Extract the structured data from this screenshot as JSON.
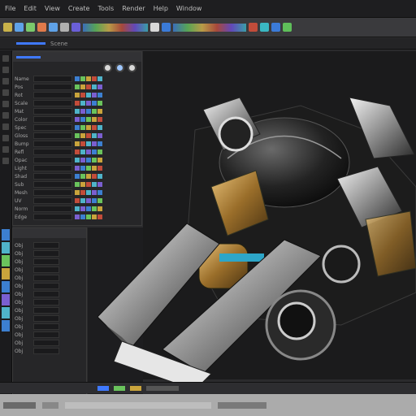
{
  "menubar": {
    "items": [
      "File",
      "Edit",
      "View",
      "Create",
      "Tools",
      "Render",
      "Help",
      "Window"
    ]
  },
  "tabrow": {
    "label": "Scene"
  },
  "left_panel": {
    "rows": [
      {
        "label": "Name"
      },
      {
        "label": "Pos"
      },
      {
        "label": "Rot"
      },
      {
        "label": "Scale"
      },
      {
        "label": "Mat"
      },
      {
        "label": "Color"
      },
      {
        "label": "Spec"
      },
      {
        "label": "Gloss"
      },
      {
        "label": "Bump"
      },
      {
        "label": "Refl"
      },
      {
        "label": "Opac"
      },
      {
        "label": "Light"
      },
      {
        "label": "Shad"
      },
      {
        "label": "Sub"
      },
      {
        "label": "Mesh"
      },
      {
        "label": "UV"
      },
      {
        "label": "Norm"
      },
      {
        "label": "Edge"
      }
    ]
  },
  "outliner": {
    "rows": [
      {
        "label": "Obj"
      },
      {
        "label": "Obj"
      },
      {
        "label": "Obj"
      },
      {
        "label": "Obj"
      },
      {
        "label": "Obj"
      },
      {
        "label": "Obj"
      },
      {
        "label": "Obj"
      },
      {
        "label": "Obj"
      },
      {
        "label": "Obj"
      },
      {
        "label": "Obj"
      },
      {
        "label": "Obj"
      },
      {
        "label": "Obj"
      },
      {
        "label": "Obj"
      },
      {
        "label": "Obj"
      }
    ]
  },
  "colors": {
    "accent": "#3f79ff",
    "metal_dark": "#1a1a1a",
    "metal_light": "#d9d9d9",
    "gold": "#b08a3a"
  }
}
